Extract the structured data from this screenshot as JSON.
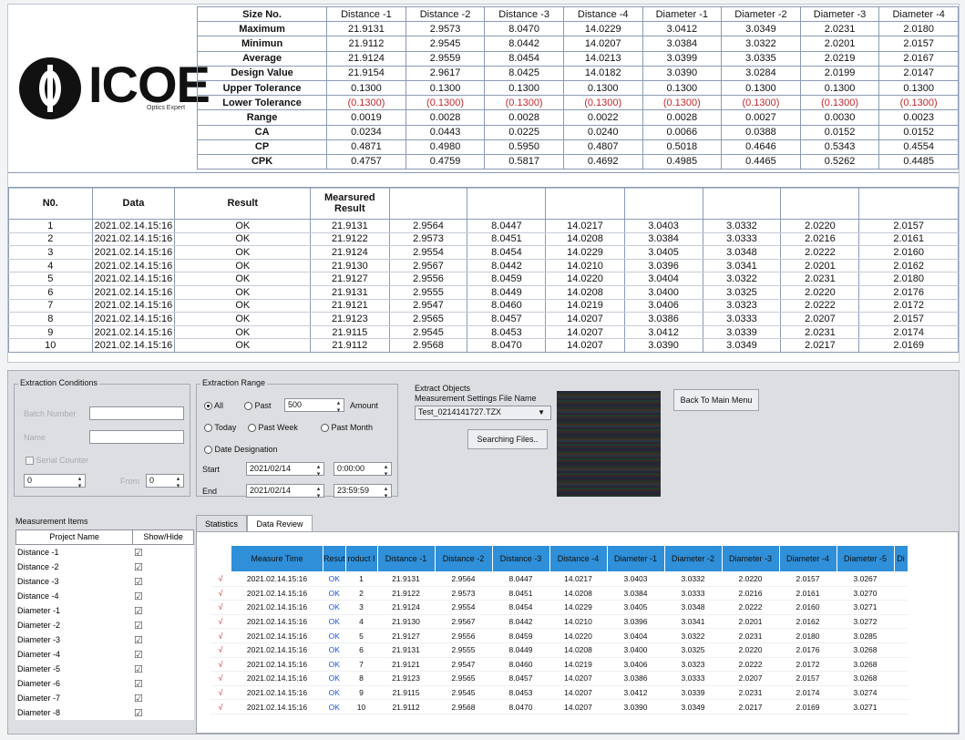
{
  "logo": {
    "word": "ICOE",
    "tagline": "Optics Expert"
  },
  "report": {
    "stats_header": "Size No.",
    "columns": [
      "Distance -1",
      "Distance -2",
      "Distance -3",
      "Distance -4",
      "Diameter -1",
      "Diameter -2",
      "Diameter -3",
      "Diameter -4"
    ],
    "stats": [
      {
        "label": "Maximum",
        "values": [
          "21.9131",
          "2.9573",
          "8.0470",
          "14.0229",
          "3.0412",
          "3.0349",
          "2.0231",
          "2.0180"
        ]
      },
      {
        "label": "Minimun",
        "values": [
          "21.9112",
          "2.9545",
          "8.0442",
          "14.0207",
          "3.0384",
          "3.0322",
          "2.0201",
          "2.0157"
        ]
      },
      {
        "label": "Average",
        "values": [
          "21.9124",
          "2.9559",
          "8.0454",
          "14.0213",
          "3.0399",
          "3.0335",
          "2.0219",
          "2.0167"
        ]
      },
      {
        "label": "Design Value",
        "values": [
          "21.9154",
          "2.9617",
          "8.0425",
          "14.0182",
          "3.0390",
          "3.0284",
          "2.0199",
          "2.0147"
        ]
      },
      {
        "label": "Upper Tolerance",
        "values": [
          "0.1300",
          "0.1300",
          "0.1300",
          "0.1300",
          "0.1300",
          "0.1300",
          "0.1300",
          "0.1300"
        ]
      },
      {
        "label": "Lower Tolerance",
        "values": [
          "(0.1300)",
          "(0.1300)",
          "(0.1300)",
          "(0.1300)",
          "(0.1300)",
          "(0.1300)",
          "(0.1300)",
          "(0.1300)"
        ],
        "negative": true
      },
      {
        "label": "Range",
        "values": [
          "0.0019",
          "0.0028",
          "0.0028",
          "0.0022",
          "0.0028",
          "0.0027",
          "0.0030",
          "0.0023"
        ]
      },
      {
        "label": "CA",
        "values": [
          "0.0234",
          "0.0443",
          "0.0225",
          "0.0240",
          "0.0066",
          "0.0388",
          "0.0152",
          "0.0152"
        ]
      },
      {
        "label": "CP",
        "values": [
          "0.4871",
          "0.4980",
          "0.5950",
          "0.4807",
          "0.5018",
          "0.4646",
          "0.5343",
          "0.4554"
        ]
      },
      {
        "label": "CPK",
        "values": [
          "0.4757",
          "0.4759",
          "0.5817",
          "0.4692",
          "0.4985",
          "0.4465",
          "0.5262",
          "0.4485"
        ]
      }
    ],
    "meas_headers": [
      "N0.",
      "Data",
      "Result",
      "Mearsured Result",
      "",
      "",
      "",
      "",
      "",
      "",
      ""
    ],
    "rows": [
      [
        "1",
        "2021.02.14.15:16",
        "OK",
        "21.9131",
        "2.9564",
        "8.0447",
        "14.0217",
        "3.0403",
        "3.0332",
        "2.0220",
        "2.0157"
      ],
      [
        "2",
        "2021.02.14.15:16",
        "OK",
        "21.9122",
        "2.9573",
        "8.0451",
        "14.0208",
        "3.0384",
        "3.0333",
        "2.0216",
        "2.0161"
      ],
      [
        "3",
        "2021.02.14.15:16",
        "OK",
        "21.9124",
        "2.9554",
        "8.0454",
        "14.0229",
        "3.0405",
        "3.0348",
        "2.0222",
        "2.0160"
      ],
      [
        "4",
        "2021.02.14.15:16",
        "OK",
        "21.9130",
        "2.9567",
        "8.0442",
        "14.0210",
        "3.0396",
        "3.0341",
        "2.0201",
        "2.0162"
      ],
      [
        "5",
        "2021.02.14.15:16",
        "OK",
        "21.9127",
        "2.9556",
        "8.0459",
        "14.0220",
        "3.0404",
        "3.0322",
        "2.0231",
        "2.0180"
      ],
      [
        "6",
        "2021.02.14.15:16",
        "OK",
        "21.9131",
        "2.9555",
        "8.0449",
        "14.0208",
        "3.0400",
        "3.0325",
        "2.0220",
        "2.0176"
      ],
      [
        "7",
        "2021.02.14.15:16",
        "OK",
        "21.9121",
        "2.9547",
        "8.0460",
        "14.0219",
        "3.0406",
        "3.0323",
        "2.0222",
        "2.0172"
      ],
      [
        "8",
        "2021.02.14.15:16",
        "OK",
        "21.9123",
        "2.9565",
        "8.0457",
        "14.0207",
        "3.0386",
        "3.0333",
        "2.0207",
        "2.0157"
      ],
      [
        "9",
        "2021.02.14.15:16",
        "OK",
        "21.9115",
        "2.9545",
        "8.0453",
        "14.0207",
        "3.0412",
        "3.0339",
        "2.0231",
        "2.0174"
      ],
      [
        "10",
        "2021.02.14.15:16",
        "OK",
        "21.9112",
        "2.9568",
        "8.0470",
        "14.0207",
        "3.0390",
        "3.0349",
        "2.0217",
        "2.0169"
      ]
    ]
  },
  "app": {
    "extraction_conditions": {
      "title": "Extraction Conditions",
      "batch_label": "Batch Number",
      "name_label": "Name",
      "serial_label": "Serial Counter",
      "serial_value": "0",
      "from_label": "From",
      "from_value": "0"
    },
    "extraction_range": {
      "title": "Extraction Range",
      "all": "All",
      "past": "Past",
      "past_value": "500",
      "amount": "Amount",
      "today": "Today",
      "past_week": "Past Week",
      "past_month": "Past Month",
      "date_designation": "Date Designation",
      "start_label": "Start",
      "start_date": "2021/02/14",
      "start_time": "0:00:00",
      "end_label": "End",
      "end_date": "2021/02/14",
      "end_time": "23:59:59"
    },
    "extract_objects": {
      "title": "Extract Objects",
      "file_label": "Measurement Settings File Name",
      "file_value": "Test_0214141727.TZX",
      "search_button": "Searching Files..",
      "back_button": "Back To Main Menu"
    },
    "measurement_items": {
      "title": "Measurement Items",
      "col_project": "Project Name",
      "col_show": "Show/Hide",
      "items": [
        "Distance -1",
        "Distance -2",
        "Distance -3",
        "Distance -4",
        "Diameter -1",
        "Diameter -2",
        "Diameter -3",
        "Diameter -4",
        "Diameter -5",
        "Diameter -6",
        "Diameter -7",
        "Diameter -8"
      ],
      "check_glyph": "☑"
    },
    "tabs": [
      "Statistics",
      "Data Review"
    ],
    "grid": {
      "headers": [
        "",
        "Measure Time",
        "Resut",
        "roduct I",
        "Distance -1",
        "Distance -2",
        "Distance -3",
        "Distance -4",
        "Diameter -1",
        "Diameter -2",
        "Diameter -3",
        "Diameter -4",
        "Diameter -5",
        "Di"
      ],
      "tick": "√",
      "rows": [
        [
          "2021.02.14.15:16",
          "OK",
          "1",
          "21.9131",
          "2.9564",
          "8.0447",
          "14.0217",
          "3.0403",
          "3.0332",
          "2.0220",
          "2.0157",
          "3.0267",
          ""
        ],
        [
          "2021.02.14.15:16",
          "OK",
          "2",
          "21.9122",
          "2.9573",
          "8.0451",
          "14.0208",
          "3.0384",
          "3.0333",
          "2.0216",
          "2.0161",
          "3.0270",
          ""
        ],
        [
          "2021.02.14.15:16",
          "OK",
          "3",
          "21.9124",
          "2.9554",
          "8.0454",
          "14.0229",
          "3.0405",
          "3.0348",
          "2.0222",
          "2.0160",
          "3.0271",
          ""
        ],
        [
          "2021.02.14.15:16",
          "OK",
          "4",
          "21.9130",
          "2.9567",
          "8.0442",
          "14.0210",
          "3.0396",
          "3.0341",
          "2.0201",
          "2.0162",
          "3.0272",
          ""
        ],
        [
          "2021.02.14.15:16",
          "OK",
          "5",
          "21.9127",
          "2.9556",
          "8.0459",
          "14.0220",
          "3.0404",
          "3.0322",
          "2.0231",
          "2.0180",
          "3.0285",
          ""
        ],
        [
          "2021.02.14.15:16",
          "OK",
          "6",
          "21.9131",
          "2.9555",
          "8.0449",
          "14.0208",
          "3.0400",
          "3.0325",
          "2.0220",
          "2.0176",
          "3.0268",
          ""
        ],
        [
          "2021.02.14.15:16",
          "OK",
          "7",
          "21.9121",
          "2.9547",
          "8.0460",
          "14.0219",
          "3.0406",
          "3.0323",
          "2.0222",
          "2.0172",
          "3.0268",
          ""
        ],
        [
          "2021.02.14.15:16",
          "OK",
          "8",
          "21.9123",
          "2.9565",
          "8.0457",
          "14.0207",
          "3.0386",
          "3.0333",
          "2.0207",
          "2.0157",
          "3.0268",
          ""
        ],
        [
          "2021.02.14.15:16",
          "OK",
          "9",
          "21.9115",
          "2.9545",
          "8.0453",
          "14.0207",
          "3.0412",
          "3.0339",
          "2.0231",
          "2.0174",
          "3.0274",
          ""
        ],
        [
          "2021.02.14.15:16",
          "OK",
          "10",
          "21.9112",
          "2.9568",
          "8.0470",
          "14.0207",
          "3.0390",
          "3.0349",
          "2.0217",
          "2.0169",
          "3.0271",
          ""
        ]
      ]
    }
  },
  "colors": {
    "negative": "#c0282d",
    "ok_blue": "#1a52d8",
    "header_blue": "#2f8fd8",
    "tick_red": "#d0303a"
  }
}
